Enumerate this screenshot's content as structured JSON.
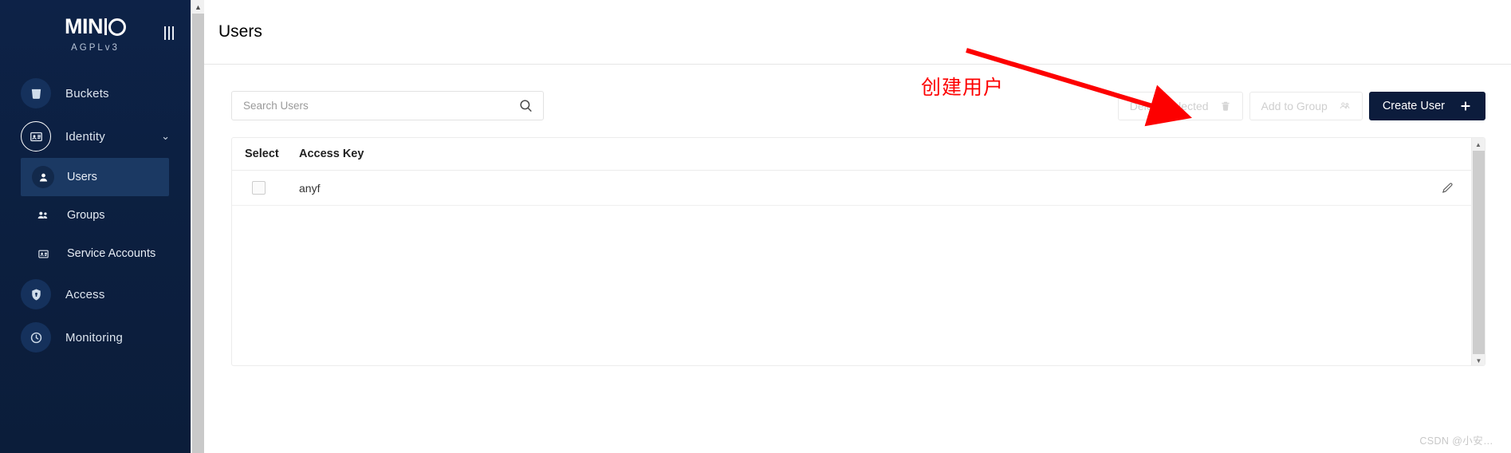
{
  "sidebar": {
    "logo": {
      "text_min": "MIN",
      "text_o": "O",
      "subtitle": "AGPLv3"
    },
    "collapse_label": "collapse-menu",
    "items": [
      {
        "label": "Buckets",
        "icon": "bucket-icon"
      },
      {
        "label": "Identity",
        "icon": "identity-card-icon",
        "chevron": "⌄"
      },
      {
        "label": "Users",
        "icon": "user-icon",
        "active": true
      },
      {
        "label": "Groups",
        "icon": "groups-icon"
      },
      {
        "label": "Service Accounts",
        "icon": "service-account-icon"
      },
      {
        "label": "Access",
        "icon": "shield-lock-icon"
      },
      {
        "label": "Monitoring",
        "icon": "monitoring-icon"
      }
    ]
  },
  "header": {
    "title": "Users"
  },
  "search": {
    "placeholder": "Search Users",
    "value": "",
    "icon": "search-icon"
  },
  "toolbar": {
    "delete_selected": "Delete Selected",
    "add_to_group": "Add to Group",
    "create_user": "Create User",
    "create_user_icon": "plus-icon",
    "delete_icon": "trash-icon",
    "group_icon": "groups-icon"
  },
  "table": {
    "columns": [
      "Select",
      "Access Key"
    ],
    "rows": [
      {
        "selected": false,
        "access_key": "anyf",
        "edit_icon": "pencil-icon"
      }
    ]
  },
  "annotation": {
    "text": "创建用户",
    "color": "#fd0000"
  },
  "watermark": {
    "text": "CSDN @小安…"
  },
  "colors": {
    "sidebar_bg": "#0d2247",
    "primary_button": "#0c1c3c",
    "annotation_red": "#fd0000"
  }
}
